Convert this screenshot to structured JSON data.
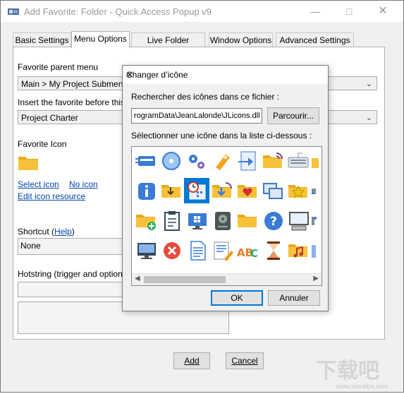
{
  "window": {
    "title": "Add Favorite: Folder - Quick Access Popup v9"
  },
  "tabs": [
    {
      "label": "Basic Settings"
    },
    {
      "label": "Menu Options"
    },
    {
      "label": "Live Folder Options"
    },
    {
      "label": "Window Options"
    },
    {
      "label": "Advanced Settings"
    }
  ],
  "form": {
    "parent_menu_label": "Favorite parent menu",
    "parent_menu_value": "Main > My Project Submenu",
    "insert_before_label": "Insert the favorite before this item",
    "insert_before_value": "Project Charter",
    "icon_label": "Favorite Icon",
    "select_icon": "Select icon",
    "no_icon": "No icon",
    "edit_icon_resource": "Edit icon resource",
    "shortcut_label": "Shortcut",
    "shortcut_help": "Help",
    "shortcut_value": "None",
    "hotstring_label": "Hotstring (trigger and options)"
  },
  "buttons": {
    "add": "Add",
    "cancel": "Cancel"
  },
  "dialog": {
    "title": "Changer d’icône",
    "search_label": "Rechercher des icônes dans ce fichier :",
    "file_value": "rogramData\\JeanLalonde\\JLicons.dll",
    "browse": "Parcourir...",
    "select_label": "Sélectionner une icône dans la liste ci-dessous :",
    "ok": "OK",
    "cancel": "Annuler",
    "icons": [
      [
        "card-icon",
        "cd-icon",
        "gears-icon",
        "tag-hand-icon",
        "arrow-doc-icon",
        "folder-wifi-icon",
        "keyboard-icon",
        "folder-partial-icon"
      ],
      [
        "info-icon",
        "folder-download-icon",
        "calendar-clock-icon",
        "folder-arrow-down-icon",
        "folder-heart-icon",
        "windows-stack-icon",
        "folder-star-icon",
        "connector-icon"
      ],
      [
        "folder-add-icon",
        "clipboard-icon",
        "windows-monitor-icon",
        "hard-drive-icon",
        "folder-icon",
        "help-icon",
        "computer-icon",
        "network-icon"
      ],
      [
        "monitor-icon",
        "close-red-icon",
        "document-icon",
        "edit-doc-icon",
        "spellcheck-icon",
        "hourglass-icon",
        "folder-music-icon",
        "partial-icon"
      ]
    ]
  },
  "watermark": "www.xiazaiba.com",
  "colors": {
    "accent": "#0078d7",
    "folder": "#f7c23a",
    "link": "#0645ad"
  }
}
